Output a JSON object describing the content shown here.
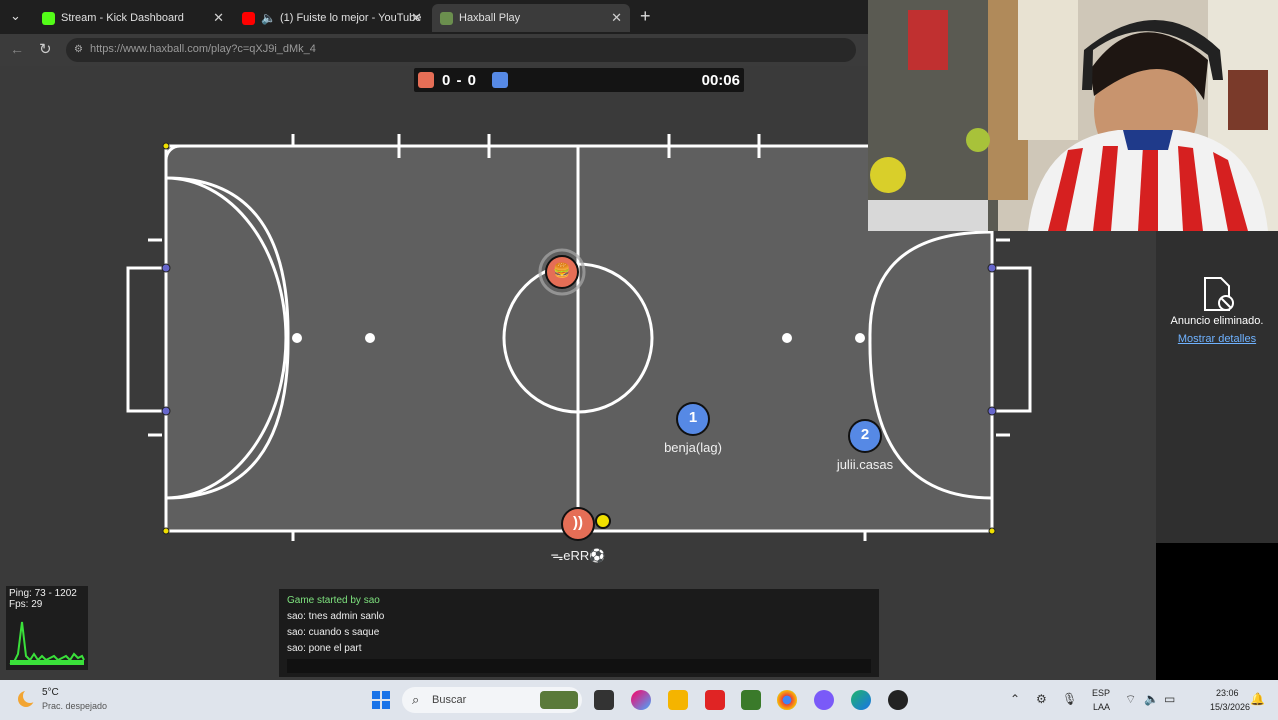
{
  "browser": {
    "tabs": [
      {
        "title": "Stream - Kick Dashboard",
        "icon": "kick-icon",
        "color": "#53fc18"
      },
      {
        "title": "(1) Fuiste lo mejor - YouTube",
        "icon": "youtube-icon",
        "color": "#ff0000"
      },
      {
        "title": "Haxball Play",
        "icon": "haxball-icon",
        "color": "#6b8f4e"
      }
    ],
    "new_tab": "+",
    "url": "https://www.haxball.com/play?c=qXJ9i_dMk_4"
  },
  "game": {
    "score_text": "0 - 0",
    "time": "00:06",
    "red_color": "#e56e56",
    "blue_color": "#5689e5",
    "players": [
      {
        "name": "",
        "team": "red",
        "avatar": "🍔"
      },
      {
        "name": "ᯓeRR⚽",
        "team": "red",
        "avatar": "))"
      },
      {
        "name": "benja(lag)",
        "team": "blue",
        "avatar": "1"
      },
      {
        "name": "julii.casas",
        "team": "blue",
        "avatar": "2"
      }
    ]
  },
  "stats": {
    "ping": "Ping: 73 - 1202",
    "fps": "Fps: 29"
  },
  "chat": {
    "lines": [
      "Game started by sao",
      "sao: tnes admin sanlo",
      "sao: cuando s saque",
      "sao: pone el part"
    ]
  },
  "ad": {
    "text": "Anuncio eliminado.",
    "link": "Mostrar detalles"
  },
  "taskbar": {
    "weather_temp": "5°C",
    "weather_desc": "Prac. despejado",
    "search_placeholder": "Buscar",
    "lang1": "ESP",
    "lang2": "LAA",
    "time": "23:06",
    "date": "15/3/2026"
  }
}
